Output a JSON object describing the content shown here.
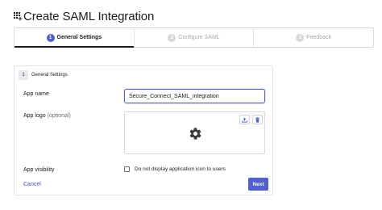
{
  "page": {
    "title": "Create SAML Integration",
    "icon": "app-grid-add-icon"
  },
  "steps": [
    {
      "number": "1",
      "label": "General Settings",
      "active": true
    },
    {
      "number": "2",
      "label": "Configure SAML",
      "active": false
    },
    {
      "number": "3",
      "label": "Feedback",
      "active": false
    }
  ],
  "form": {
    "section_number": "1",
    "section_title": "General Settings",
    "app_name": {
      "label": "App name",
      "value": "Secure_Connect_SAML_integration"
    },
    "app_logo": {
      "label": "App logo",
      "optional": "(optional)",
      "upload_icon": "upload-icon",
      "delete_icon": "trash-icon",
      "placeholder_icon": "gear-icon"
    },
    "app_visibility": {
      "label": "App visibility",
      "checkbox_label": "Do not display application icon to users",
      "checked": false
    },
    "actions": {
      "cancel_label": "Cancel",
      "next_label": "Next"
    }
  },
  "colors": {
    "accent": "#4f5ed0",
    "link": "#3c4fc0",
    "text": "#1d1d21",
    "muted": "#a7a7ad",
    "border": "#d7d7dc"
  }
}
